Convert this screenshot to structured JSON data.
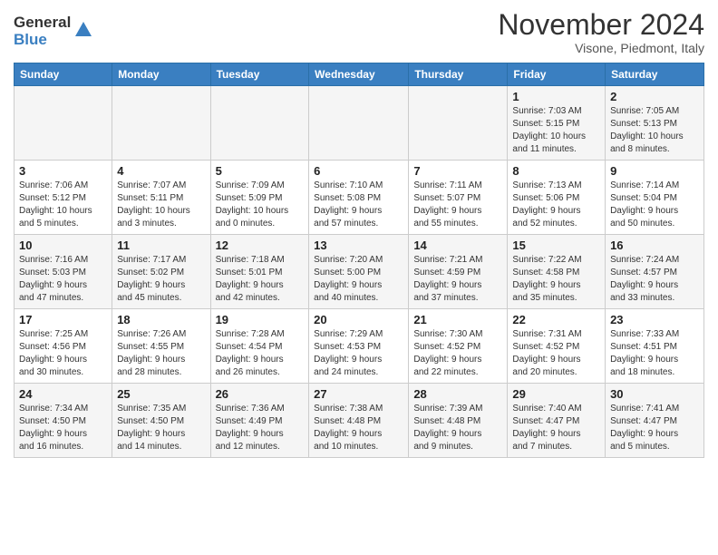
{
  "header": {
    "logo_general": "General",
    "logo_blue": "Blue",
    "month_title": "November 2024",
    "location": "Visone, Piedmont, Italy"
  },
  "days_of_week": [
    "Sunday",
    "Monday",
    "Tuesday",
    "Wednesday",
    "Thursday",
    "Friday",
    "Saturday"
  ],
  "weeks": [
    [
      {
        "day": "",
        "info": ""
      },
      {
        "day": "",
        "info": ""
      },
      {
        "day": "",
        "info": ""
      },
      {
        "day": "",
        "info": ""
      },
      {
        "day": "",
        "info": ""
      },
      {
        "day": "1",
        "info": "Sunrise: 7:03 AM\nSunset: 5:15 PM\nDaylight: 10 hours\nand 11 minutes."
      },
      {
        "day": "2",
        "info": "Sunrise: 7:05 AM\nSunset: 5:13 PM\nDaylight: 10 hours\nand 8 minutes."
      }
    ],
    [
      {
        "day": "3",
        "info": "Sunrise: 7:06 AM\nSunset: 5:12 PM\nDaylight: 10 hours\nand 5 minutes."
      },
      {
        "day": "4",
        "info": "Sunrise: 7:07 AM\nSunset: 5:11 PM\nDaylight: 10 hours\nand 3 minutes."
      },
      {
        "day": "5",
        "info": "Sunrise: 7:09 AM\nSunset: 5:09 PM\nDaylight: 10 hours\nand 0 minutes."
      },
      {
        "day": "6",
        "info": "Sunrise: 7:10 AM\nSunset: 5:08 PM\nDaylight: 9 hours\nand 57 minutes."
      },
      {
        "day": "7",
        "info": "Sunrise: 7:11 AM\nSunset: 5:07 PM\nDaylight: 9 hours\nand 55 minutes."
      },
      {
        "day": "8",
        "info": "Sunrise: 7:13 AM\nSunset: 5:06 PM\nDaylight: 9 hours\nand 52 minutes."
      },
      {
        "day": "9",
        "info": "Sunrise: 7:14 AM\nSunset: 5:04 PM\nDaylight: 9 hours\nand 50 minutes."
      }
    ],
    [
      {
        "day": "10",
        "info": "Sunrise: 7:16 AM\nSunset: 5:03 PM\nDaylight: 9 hours\nand 47 minutes."
      },
      {
        "day": "11",
        "info": "Sunrise: 7:17 AM\nSunset: 5:02 PM\nDaylight: 9 hours\nand 45 minutes."
      },
      {
        "day": "12",
        "info": "Sunrise: 7:18 AM\nSunset: 5:01 PM\nDaylight: 9 hours\nand 42 minutes."
      },
      {
        "day": "13",
        "info": "Sunrise: 7:20 AM\nSunset: 5:00 PM\nDaylight: 9 hours\nand 40 minutes."
      },
      {
        "day": "14",
        "info": "Sunrise: 7:21 AM\nSunset: 4:59 PM\nDaylight: 9 hours\nand 37 minutes."
      },
      {
        "day": "15",
        "info": "Sunrise: 7:22 AM\nSunset: 4:58 PM\nDaylight: 9 hours\nand 35 minutes."
      },
      {
        "day": "16",
        "info": "Sunrise: 7:24 AM\nSunset: 4:57 PM\nDaylight: 9 hours\nand 33 minutes."
      }
    ],
    [
      {
        "day": "17",
        "info": "Sunrise: 7:25 AM\nSunset: 4:56 PM\nDaylight: 9 hours\nand 30 minutes."
      },
      {
        "day": "18",
        "info": "Sunrise: 7:26 AM\nSunset: 4:55 PM\nDaylight: 9 hours\nand 28 minutes."
      },
      {
        "day": "19",
        "info": "Sunrise: 7:28 AM\nSunset: 4:54 PM\nDaylight: 9 hours\nand 26 minutes."
      },
      {
        "day": "20",
        "info": "Sunrise: 7:29 AM\nSunset: 4:53 PM\nDaylight: 9 hours\nand 24 minutes."
      },
      {
        "day": "21",
        "info": "Sunrise: 7:30 AM\nSunset: 4:52 PM\nDaylight: 9 hours\nand 22 minutes."
      },
      {
        "day": "22",
        "info": "Sunrise: 7:31 AM\nSunset: 4:52 PM\nDaylight: 9 hours\nand 20 minutes."
      },
      {
        "day": "23",
        "info": "Sunrise: 7:33 AM\nSunset: 4:51 PM\nDaylight: 9 hours\nand 18 minutes."
      }
    ],
    [
      {
        "day": "24",
        "info": "Sunrise: 7:34 AM\nSunset: 4:50 PM\nDaylight: 9 hours\nand 16 minutes."
      },
      {
        "day": "25",
        "info": "Sunrise: 7:35 AM\nSunset: 4:50 PM\nDaylight: 9 hours\nand 14 minutes."
      },
      {
        "day": "26",
        "info": "Sunrise: 7:36 AM\nSunset: 4:49 PM\nDaylight: 9 hours\nand 12 minutes."
      },
      {
        "day": "27",
        "info": "Sunrise: 7:38 AM\nSunset: 4:48 PM\nDaylight: 9 hours\nand 10 minutes."
      },
      {
        "day": "28",
        "info": "Sunrise: 7:39 AM\nSunset: 4:48 PM\nDaylight: 9 hours\nand 9 minutes."
      },
      {
        "day": "29",
        "info": "Sunrise: 7:40 AM\nSunset: 4:47 PM\nDaylight: 9 hours\nand 7 minutes."
      },
      {
        "day": "30",
        "info": "Sunrise: 7:41 AM\nSunset: 4:47 PM\nDaylight: 9 hours\nand 5 minutes."
      }
    ]
  ]
}
